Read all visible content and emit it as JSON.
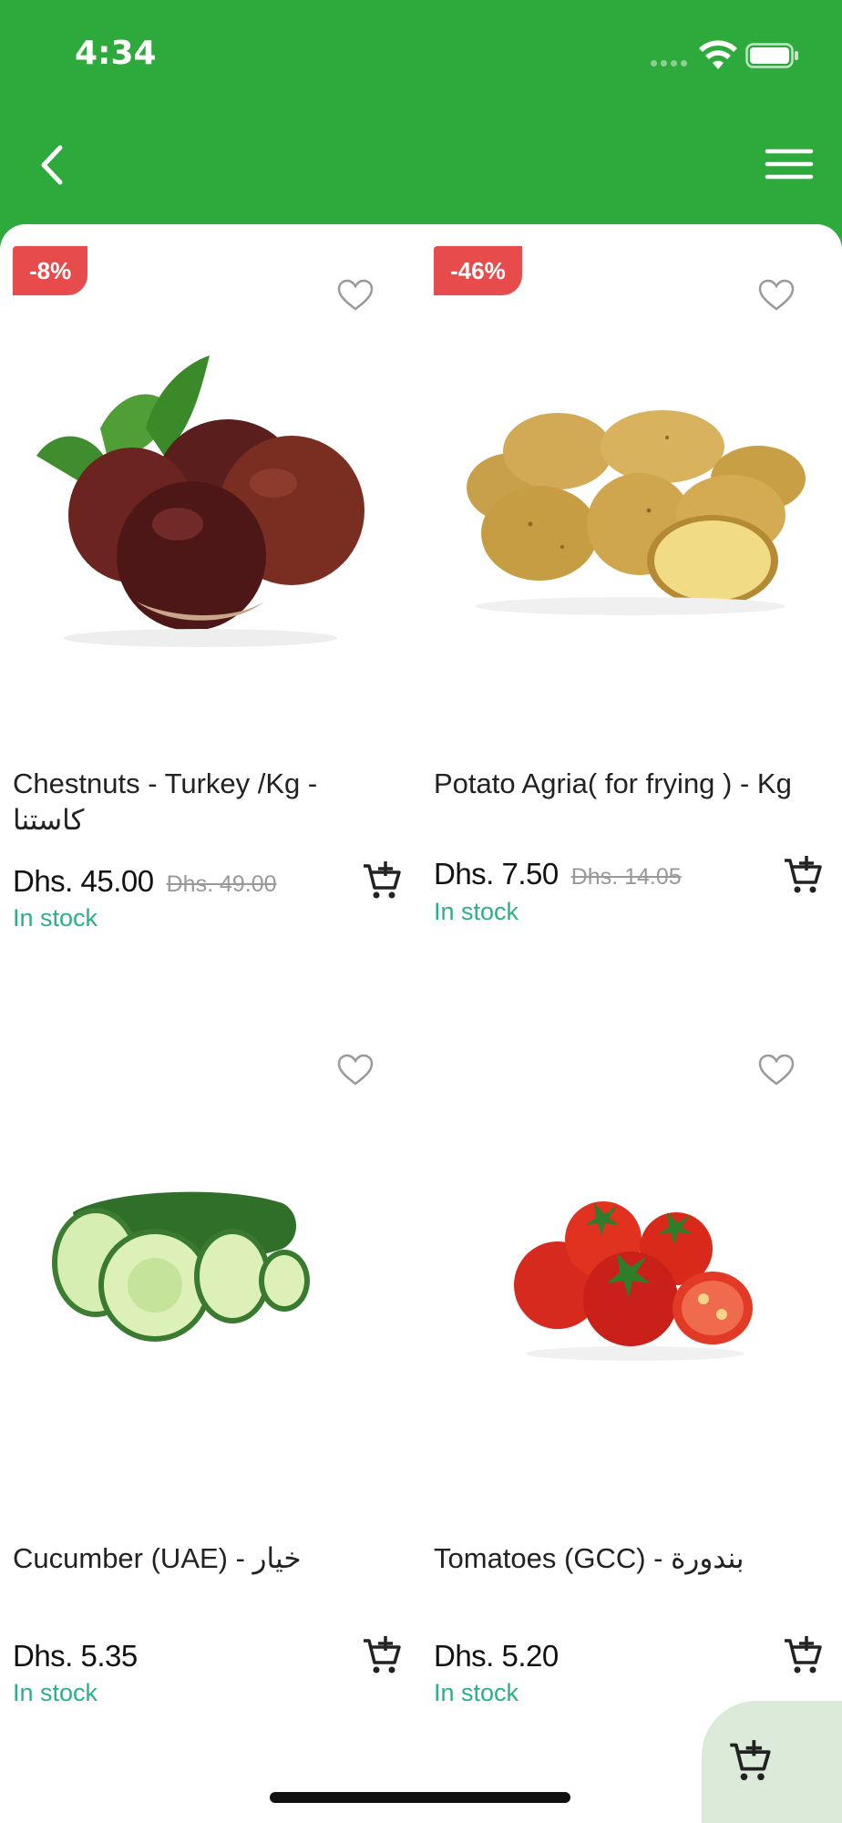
{
  "status_bar": {
    "time": "4:34"
  },
  "header": {
    "back_icon": "chevron-left-icon",
    "menu_icon": "hamburger-menu-icon",
    "color": "#2eaa3c"
  },
  "products": [
    {
      "discount": "-8%",
      "name_line1": "Chestnuts - Turkey /Kg -",
      "name_line2": "كاستنا",
      "price": "Dhs. 45.00",
      "old_price": "Dhs. 49.00",
      "stock": "In stock",
      "image": "chestnuts"
    },
    {
      "discount": "-46%",
      "name_line1": "Potato Agria( for frying ) - Kg",
      "name_line2": "",
      "price": "Dhs. 7.50",
      "old_price": "Dhs. 14.05",
      "stock": "In stock",
      "image": "potatoes"
    },
    {
      "discount": "",
      "name_line1": "Cucumber (UAE) - خيار",
      "name_line2": "",
      "price": "Dhs. 5.35",
      "old_price": "",
      "stock": "In stock",
      "image": "cucumber"
    },
    {
      "discount": "",
      "name_line1": "Tomatoes (GCC) - بندورة",
      "name_line2": "",
      "price": "Dhs. 5.20",
      "old_price": "",
      "stock": "In stock",
      "image": "tomatoes"
    }
  ],
  "colors": {
    "accent": "#2eaa3c",
    "badge": "#e84b4b",
    "stock": "#2bb08a",
    "fab": "#dcebd9"
  }
}
